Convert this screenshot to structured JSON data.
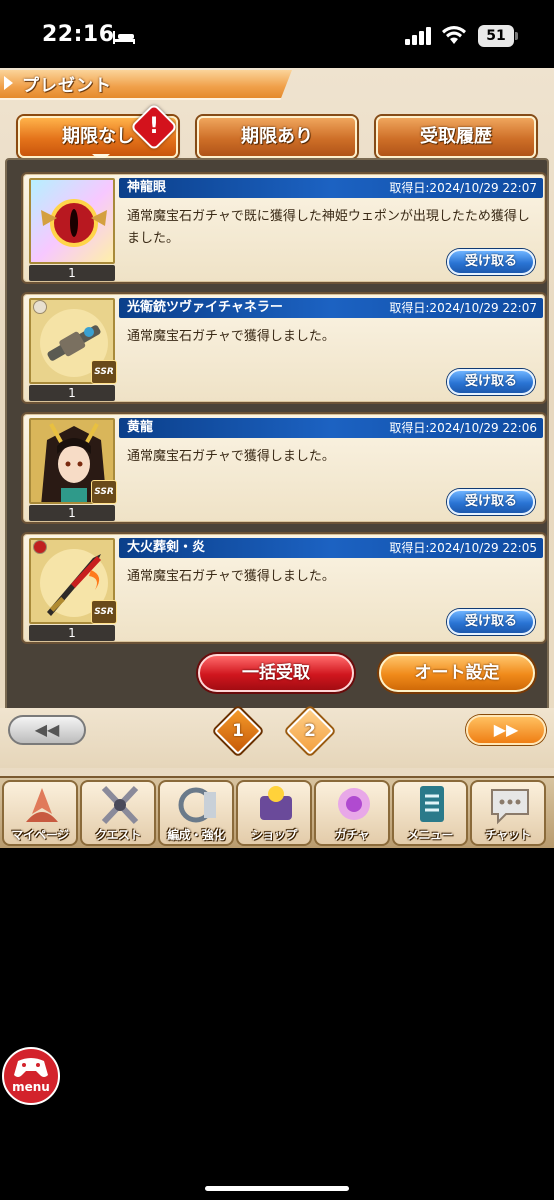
{
  "status_bar": {
    "time": "22:16",
    "battery": "51"
  },
  "header": {
    "title": "プレゼント"
  },
  "tabs": [
    {
      "label": "期限なし",
      "active": true
    },
    {
      "label": "期限あり",
      "active": false
    },
    {
      "label": "受取履歴",
      "active": false
    }
  ],
  "alert_badge": "!",
  "items": [
    {
      "name": "神龍眼",
      "date": "取得日:2024/10/29 22:07",
      "quantity": "1",
      "description": "通常魔宝石ガチャで既に獲得した神姫ウェポンが出現したため獲得しました。",
      "button": "受け取る"
    },
    {
      "name": "光衛銃ツヴァイチャネラー",
      "date": "取得日:2024/10/29 22:07",
      "quantity": "1",
      "description": "通常魔宝石ガチャで獲得しました。",
      "button": "受け取る"
    },
    {
      "name": "黄龍",
      "date": "取得日:2024/10/29 22:06",
      "quantity": "1",
      "description": "通常魔宝石ガチャで獲得しました。",
      "button": "受け取る"
    },
    {
      "name": "大火葬剣・炎",
      "date": "取得日:2024/10/29 22:05",
      "quantity": "1",
      "description": "通常魔宝石ガチャで獲得しました。",
      "button": "受け取る"
    }
  ],
  "actions": {
    "bulk_receive": "一括受取",
    "auto_settings": "オート設定"
  },
  "pagination": {
    "prev": "◀◀",
    "next": "▶▶",
    "pages": [
      "1",
      "2"
    ],
    "current": "1"
  },
  "bottom_menu": [
    {
      "label": "マイページ",
      "icon": "mypage-icon"
    },
    {
      "label": "クエスト",
      "icon": "quest-icon"
    },
    {
      "label": "編成・強化",
      "icon": "party-icon"
    },
    {
      "label": "ショップ",
      "icon": "shop-icon"
    },
    {
      "label": "ガチャ",
      "icon": "gacha-icon"
    },
    {
      "label": "メニュー",
      "icon": "menu-icon"
    },
    {
      "label": "チャット",
      "icon": "chat-icon"
    }
  ],
  "overlay_menu": {
    "label": "menu"
  },
  "colors": {
    "accent_orange": "#e4731a",
    "name_bar_blue": "#1c62c2",
    "receive_blue": "#2a74d4",
    "bulk_red": "#d0161e"
  }
}
